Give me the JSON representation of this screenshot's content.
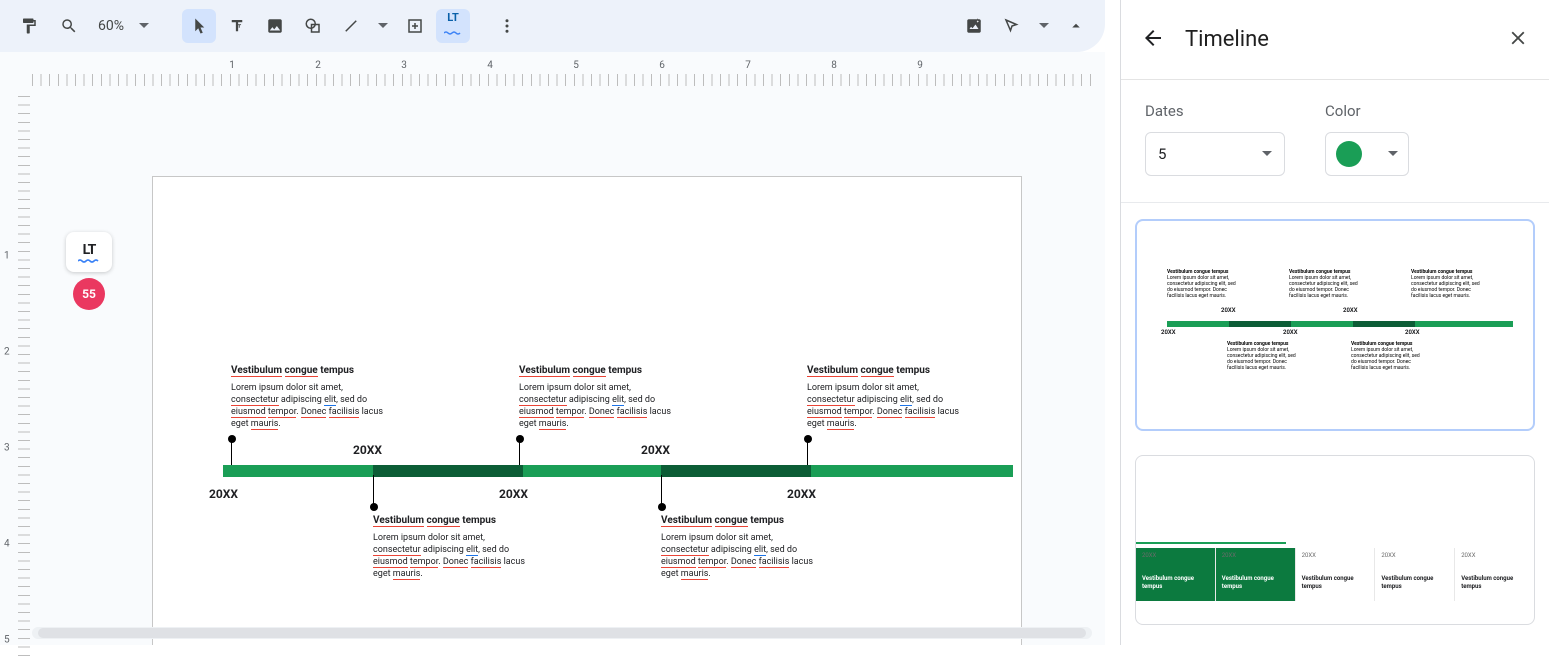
{
  "toolbar": {
    "zoom": "60%"
  },
  "lt": {
    "logo": "LT",
    "count": "55"
  },
  "ruler_h": [
    "1",
    "2",
    "3",
    "4",
    "5",
    "6",
    "7",
    "8",
    "9"
  ],
  "ruler_v": [
    "1",
    "2",
    "3",
    "4",
    "5"
  ],
  "timeline": {
    "heading": "Vestibulum congue tempus",
    "body_plain": "Lorem ipsum dolor sit amet, consectetur adipiscing elit, sed do eiusmod tempor. Donec facilisis lacus eget mauris.",
    "years_top": [
      "20XX",
      "20XX"
    ],
    "years_bot": [
      "20XX",
      "20XX",
      "20XX"
    ]
  },
  "sidebar": {
    "title": "Timeline",
    "dates_label": "Dates",
    "color_label": "Color",
    "dates_value": "5",
    "tpl1_years": [
      "20XX",
      "20XX",
      "20XX",
      "20XX",
      "20XX"
    ],
    "tpl1_heading": "Vestibulum congue tempus",
    "tpl1_body": "Lorem ipsum dolor sit amet, consectetur adipiscing elit, sed do eiusmod tempor. Donec facilisis lacus eget mauris.",
    "tpl2_years": [
      "20XX",
      "20XX",
      "20XX",
      "20XX",
      "20XX"
    ],
    "tpl2_title": "Vestibulum congue tempus"
  }
}
